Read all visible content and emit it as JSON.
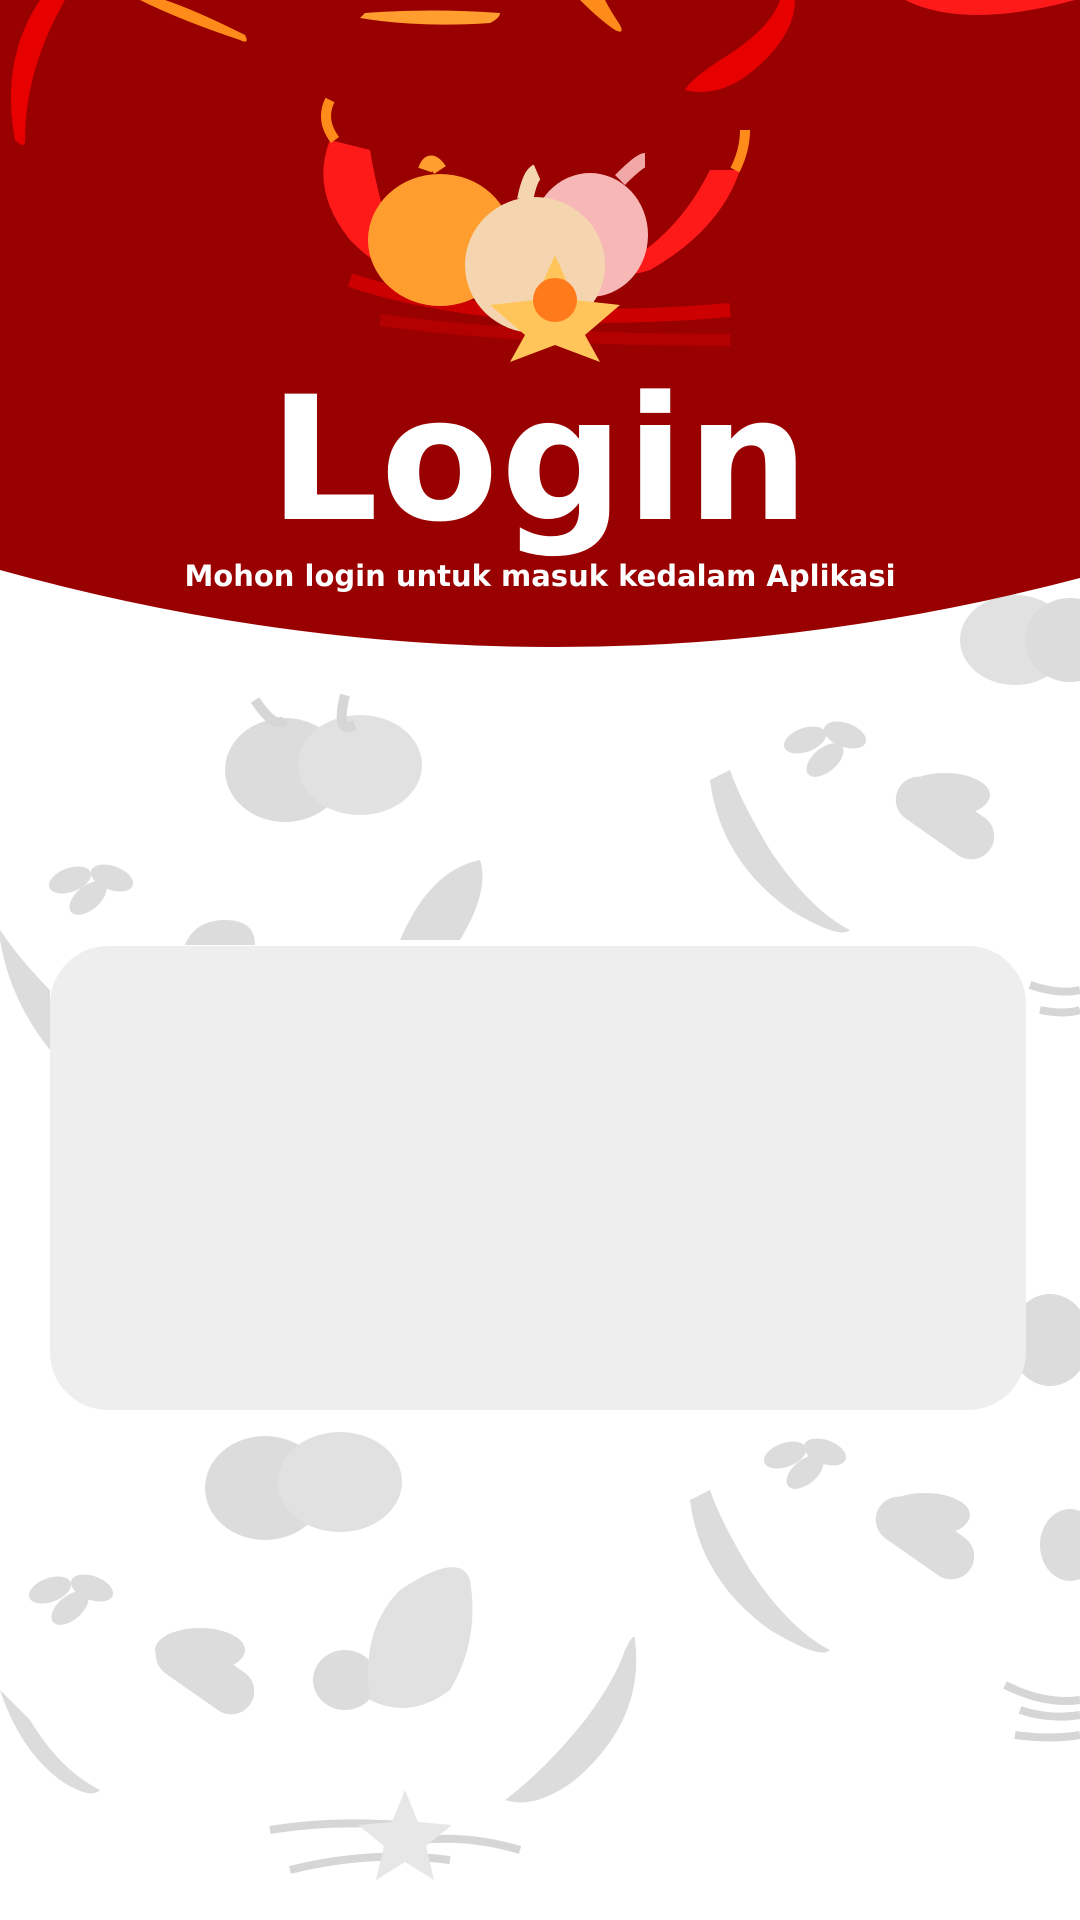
{
  "login": {
    "title": "Login",
    "subtitle": "Mohon login untuk masuk kedalam Aplikasi"
  },
  "icons": {
    "hero": "vegetables-illustration-icon",
    "pattern": [
      "garlic-icon",
      "chili-icon",
      "clove-icon",
      "leaf-icon",
      "star-anise-icon"
    ]
  },
  "colors": {
    "header": "#990000",
    "card": "#eeeeee",
    "pattern": "#cfcfcf",
    "text_on_header": "#ffffff"
  }
}
